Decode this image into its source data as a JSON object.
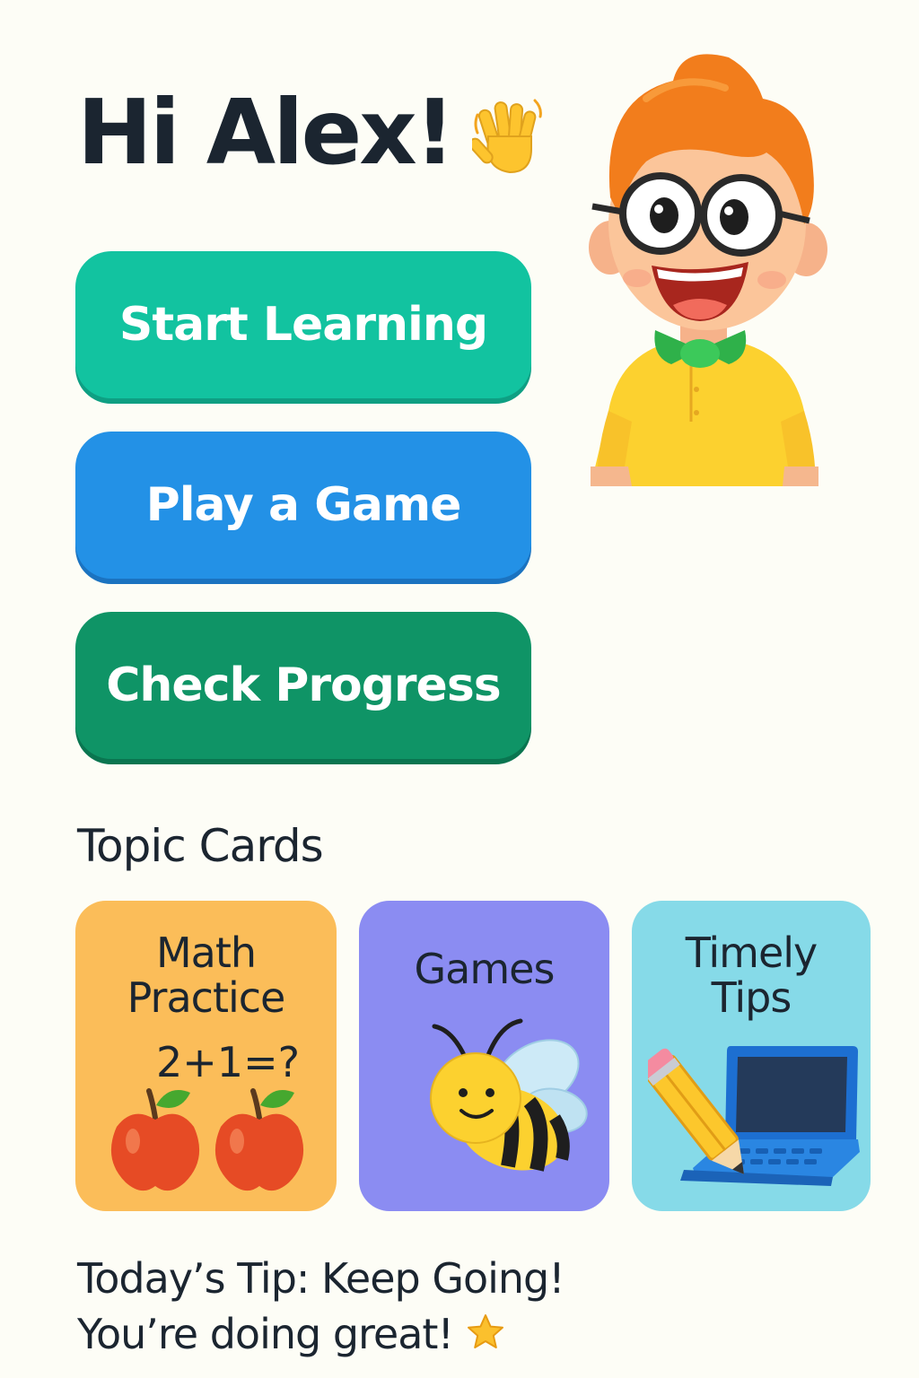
{
  "greeting": {
    "text": "Hi Alex!",
    "emoji": "waving-hand-icon"
  },
  "avatar": {
    "icon": "boy-with-glasses-avatar"
  },
  "actions": {
    "start_learning": "Start Learning",
    "play_game": "Play a Game",
    "check_progress": "Check Progress"
  },
  "topics": {
    "title": "Topic Cards",
    "cards": [
      {
        "title_line1": "Math",
        "title_line2": "Practice",
        "equation": "2+1=?",
        "icon": "apples-icon"
      },
      {
        "title_line1": "Games",
        "icon": "bee-icon"
      },
      {
        "title_line1": "Timely",
        "title_line2": "Tips",
        "icon": "pencil-laptop-icon"
      }
    ]
  },
  "tip": {
    "line1": "Today’s Tip: Keep Going!",
    "line2": "You’re doing great!",
    "emoji": "star-icon"
  },
  "colors": {
    "background": "#fdfdf6",
    "start_learning": "#12c3a0",
    "play_game": "#2391e6",
    "check_progress": "#0f9466",
    "card_math": "#fbbd59",
    "card_games": "#8b8cf2",
    "card_tips": "#86dae8",
    "text": "#1b2530"
  }
}
